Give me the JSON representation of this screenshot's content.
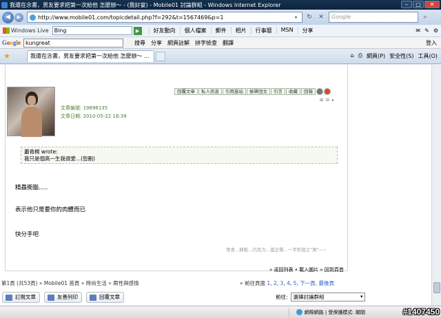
{
  "window": {
    "title": "我還在念書，男友要求把第一次給他 怎麼辦～ - (我好宴) - Mobile01 討論群組 - Windows Internet Explorer"
  },
  "address": {
    "url": "http://www.mobile01.com/topicdetail.php?f=292&t=1567469&p=1",
    "search_placeholder": "Google"
  },
  "live_toolbar": {
    "brand": "Windows Live",
    "search_value": "Bing",
    "links": [
      "好友動向",
      "個人檔案",
      "郵件",
      "相片",
      "行事曆",
      "MSN",
      "分享"
    ]
  },
  "google_toolbar": {
    "search_value": "kungreat",
    "items": [
      "搜尋",
      "分享",
      "網頁註解",
      "拼字檢查",
      "翻譯"
    ],
    "login": "登入"
  },
  "tabs": {
    "active_tab": "我還在念書，男友要求把第一次給他 怎麼辦～ ...",
    "tools": [
      "網頁(P)",
      "安全性(S)",
      "工具(O)"
    ]
  },
  "post": {
    "action_buttons": [
      "回覆文章",
      "私人訊息",
      "引用進站",
      "檢舉回文",
      "引言",
      "收藏",
      "回報"
    ],
    "article_id": "文章編號: 19696135",
    "article_date": "文章日期: 2010-05-22 16:39",
    "quote_author": "蕭青桐 wrote:",
    "quote_text": "我只是個高一生我很愛...(恕刪)",
    "line1": "精蟲衝腦.....",
    "line2": "表示他只是要你的肉體而已",
    "line3": "快分手吧",
    "signature": "零食...餅乾...巧克力...當正餐...一字形容之\"爽\"~~",
    "nav": "» 返回列表 • 載入圖片 » 回到頁首"
  },
  "footer": {
    "breadcrumb": "第1頁 (共53頁) » Mobile01 首頁 » 時尚生活 » 兩性與感情",
    "pages_label": "» 前往頁面",
    "pages": [
      "1",
      "2",
      "3",
      "4",
      "5"
    ],
    "pages_tail": "下一頁, 最後頁",
    "buttons": [
      "訂閱文章",
      "友善列印",
      "回覆文章"
    ],
    "jump_label": "前往:",
    "jump_select": "選擇討論群組"
  },
  "status": {
    "zone": "網際網路 | 受保護模式: 關閉"
  },
  "watermark": "#1407450"
}
